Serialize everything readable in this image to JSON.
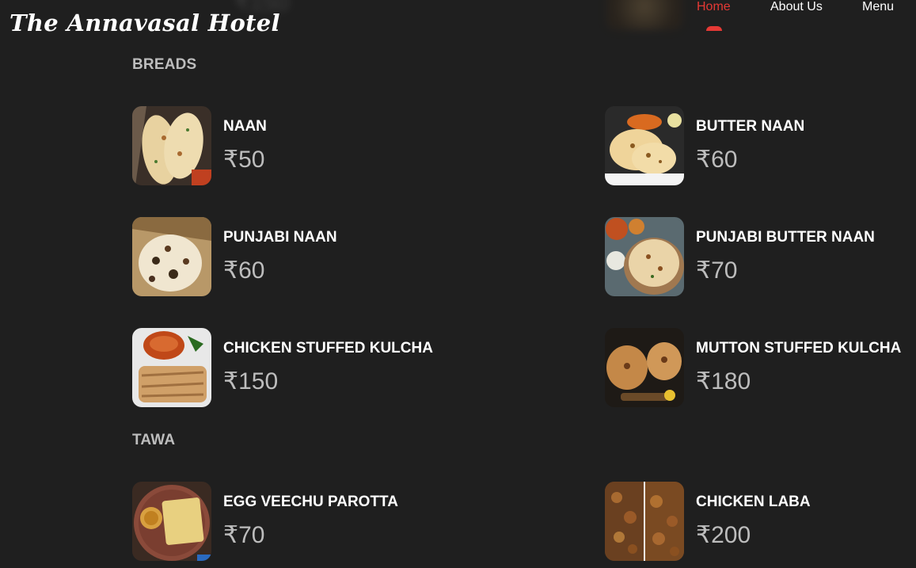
{
  "header": {
    "brand": "The Annavasal Hotel",
    "nav": [
      {
        "label": "Home",
        "active": true
      },
      {
        "label": "About Us",
        "active": false
      },
      {
        "label": "Menu",
        "active": false
      }
    ],
    "ghost_price": "₹150"
  },
  "colors": {
    "background": "#1f1f1f",
    "accent": "#e53935",
    "section_title": "#bdbdbd",
    "price": "#bdbdbd"
  },
  "sections": [
    {
      "title": "BREADS",
      "items": [
        {
          "name": "NAAN",
          "price": "₹50",
          "image": "naan-photo"
        },
        {
          "name": "BUTTER NAAN",
          "price": "₹60",
          "image": "butter-naan-photo"
        },
        {
          "name": "PUNJABI NAAN",
          "price": "₹60",
          "image": "punjabi-naan-photo"
        },
        {
          "name": "PUNJABI BUTTER NAAN",
          "price": "₹70",
          "image": "punjabi-butter-naan-photo"
        },
        {
          "name": "CHICKEN STUFFED KULCHA",
          "price": "₹150",
          "image": "chicken-kulcha-photo"
        },
        {
          "name": "MUTTON STUFFED KULCHA",
          "price": "₹180",
          "image": "mutton-kulcha-photo"
        }
      ]
    },
    {
      "title": "TAWA",
      "items": [
        {
          "name": "EGG VEECHU PAROTTA",
          "price": "₹70",
          "image": "egg-veechu-parotta-photo"
        },
        {
          "name": "CHICKEN LABA",
          "price": "₹200",
          "image": "chicken-laba-photo"
        }
      ]
    }
  ]
}
